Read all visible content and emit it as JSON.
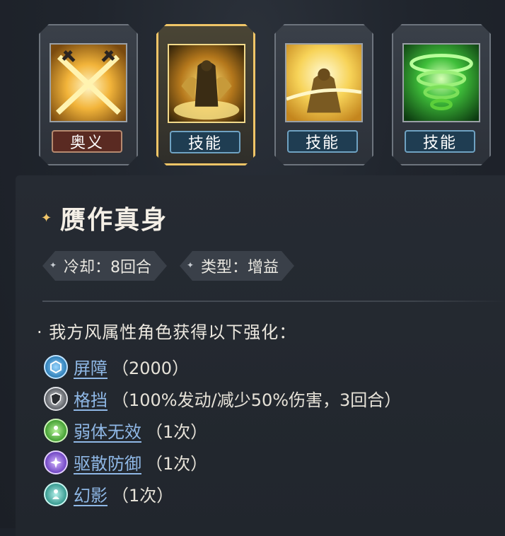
{
  "skills": [
    {
      "tag": "奥义",
      "type": "ult",
      "icon": "crossed-swords-icon",
      "selected": false
    },
    {
      "tag": "技能",
      "type": "skill",
      "icon": "golden-guardian-icon",
      "selected": true
    },
    {
      "tag": "技能",
      "type": "skill",
      "icon": "holy-light-icon",
      "selected": false
    },
    {
      "tag": "技能",
      "type": "skill",
      "icon": "green-tornado-icon",
      "selected": false
    }
  ],
  "detail": {
    "title": "赝作真身",
    "cooldown": "冷却：8回合",
    "kind": "类型：增益",
    "description": "· 我方风属性角色获得以下强化：",
    "effects": [
      {
        "name": "屏障",
        "detail": "（2000）",
        "icon": "barrier-icon",
        "color": "#4aa3d8"
      },
      {
        "name": "格挡",
        "detail": "（100%发动/减少50%伤害，3回合）",
        "icon": "block-shield-icon",
        "color": "#8a8f96"
      },
      {
        "name": "弱体无效",
        "detail": "（1次）",
        "icon": "debuff-immune-icon",
        "color": "#5cb84a"
      },
      {
        "name": "驱散防御",
        "detail": "（1次）",
        "icon": "dispel-defense-icon",
        "color": "#8a5bd6"
      },
      {
        "name": "幻影",
        "detail": "（1次）",
        "icon": "phantom-icon",
        "color": "#3fb3a8"
      }
    ]
  },
  "colors": {
    "accent": "#f0c567",
    "link": "#8fb8e6"
  }
}
